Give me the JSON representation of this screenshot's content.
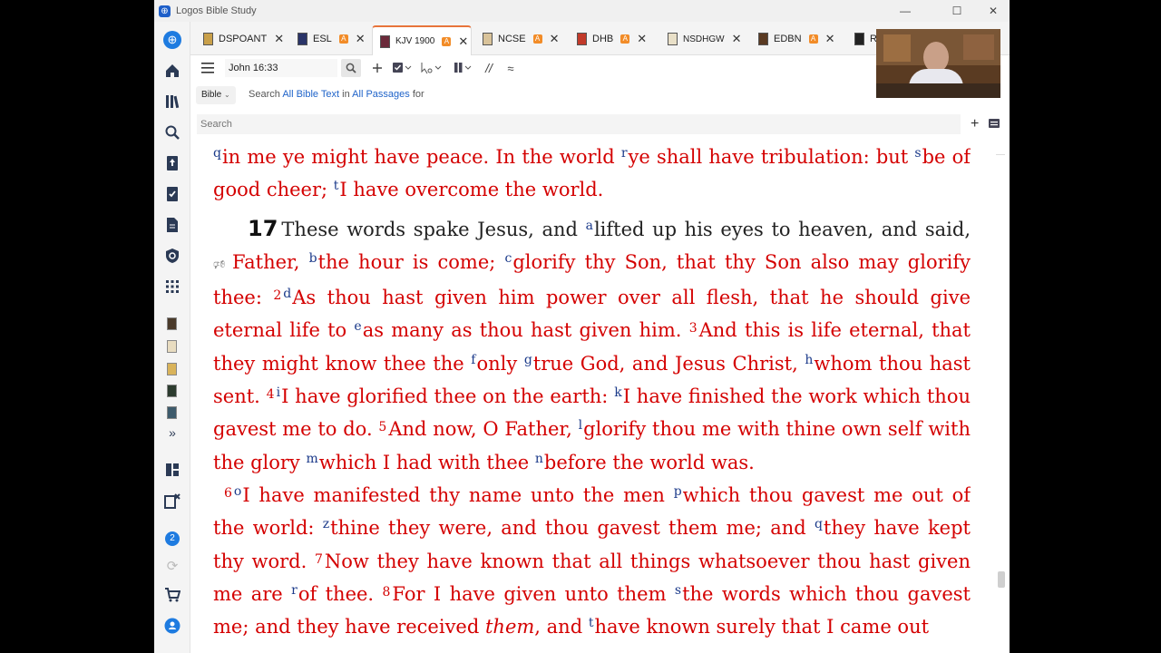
{
  "window": {
    "title": "Logos Bible Study",
    "minimize": "—",
    "maximize": "☐",
    "close": "✕"
  },
  "tabs": [
    {
      "label": "DSPOANT",
      "badge": "",
      "active": false
    },
    {
      "label": "ESL",
      "badge": "A",
      "active": false
    },
    {
      "label": "KJV 1900",
      "badge": "A",
      "active": true
    },
    {
      "label": "NCSE",
      "badge": "A",
      "active": false
    },
    {
      "label": "DHB",
      "badge": "A",
      "active": false
    },
    {
      "label": "NSDHGW",
      "badge": "",
      "active": false
    },
    {
      "label": "EDBN",
      "badge": "A",
      "active": false
    },
    {
      "label": "R",
      "badge": "",
      "active": false
    }
  ],
  "toolbar": {
    "reference": "John 16:33"
  },
  "search_row": {
    "chip": "Bible",
    "prefix": "Search",
    "scope1": "All Bible Text",
    "in": "in",
    "scope2": "All Passages",
    "suffix": "for"
  },
  "search": {
    "placeholder": "Search"
  },
  "sidebar": {
    "more": "»",
    "notification_count": "2"
  },
  "reader": {
    "l1_n1": "q",
    "l1_t1": "in me ye might have peace. In the world ",
    "l1_n2": "r",
    "l1_t2": "ye shall have tribulation: but ",
    "l1_n3": "s",
    "l1_t3": "be of good cheer; ",
    "l1_n4": "t",
    "l1_t4": "I have overcome the world.",
    "ch": "17",
    "v1_t1": "These words spake Jesus, and ",
    "v1_n1": "a",
    "v1_t2": "lifted up his eyes to heaven, and said,",
    "v1_n2": "b",
    "v1_t3": "Father, ",
    "v1_t4": "the hour is come; ",
    "v1_n3": "c",
    "v1_t5": "glorify thy Son, that thy Son also may glorify thee: ",
    "v2": "2",
    "v2_n1": "d",
    "v2_t1": "As thou hast given him power over all flesh, that he should give eternal life to ",
    "v2_n2": "e",
    "v2_t2": "as many as thou hast given him. ",
    "v3": "3",
    "v3_t1": "And this is life eternal, that they might know thee the ",
    "v3_n1": "f",
    "v3_t2": "only ",
    "v3_n2": "g",
    "v3_t3": "true God, and Jesus Christ, ",
    "v3_n3": "h",
    "v3_t4": "whom thou hast sent. ",
    "v4": "4",
    "v4_n1": "i",
    "v4_t1": "I have glorified thee on the earth: ",
    "v4_n2": "k",
    "v4_t2": "I have finished the work which thou gavest me to do. ",
    "v5": "5",
    "v5_t1": "And now, O Father, ",
    "v5_n1": "l",
    "v5_t2": "glorify thou me with thine own self with the glory ",
    "v5_n2": "m",
    "v5_t3": "which I had with thee ",
    "v5_n3": "n",
    "v5_t4": "before the world was.",
    "v6": "6",
    "v6_n1": "o",
    "v6_t1": "I have manifested thy name unto the men ",
    "v6_n2": "p",
    "v6_t2": "which thou gavest me out of the world: ",
    "v6_n3": "z",
    "v6_t3": "thine they were, and thou gavest them me; and ",
    "v6_n4": "q",
    "v6_t4": "they have kept thy word. ",
    "v7": "7",
    "v7_t1": "Now they have known that all things whatsoever thou hast given me are ",
    "v7_n1": "r",
    "v7_t2": "of thee. ",
    "v8": "8",
    "v8_t1": "For I have given unto them ",
    "v8_n1": "s",
    "v8_t2": "the words which thou gavest me; and they have received ",
    "v8_em": "them",
    "v8_t3": ", and ",
    "v8_n2": "t",
    "v8_t4": "have known surely that I came out"
  }
}
